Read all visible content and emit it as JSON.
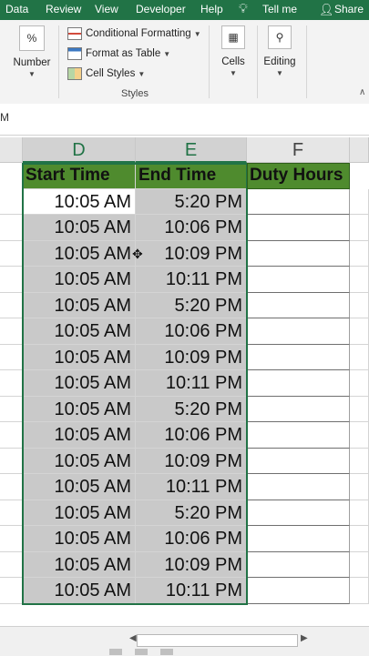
{
  "ribbon_tabs": [
    "Data",
    "Review",
    "View",
    "Developer",
    "Help",
    "Tell me",
    "Share"
  ],
  "ribbon": {
    "number_label": "Number",
    "number_icon": "%",
    "conditional_formatting": "Conditional Formatting",
    "format_as_table": "Format as Table",
    "cell_styles": "Cell Styles",
    "styles_group": "Styles",
    "cells_label": "Cells",
    "editing_label": "Editing"
  },
  "formula_bar": {
    "name_box": "M"
  },
  "columns": [
    "D",
    "E",
    "F"
  ],
  "header_row": {
    "start": "Start Time",
    "end": "End Time",
    "duty": "Duty Hours"
  },
  "rows": [
    {
      "start": "10:05 AM",
      "end": "5:20 PM"
    },
    {
      "start": "10:05 AM",
      "end": "10:06 PM"
    },
    {
      "start": "10:05 AM",
      "end": "10:09 PM"
    },
    {
      "start": "10:05 AM",
      "end": "10:11 PM"
    },
    {
      "start": "10:05 AM",
      "end": "5:20 PM"
    },
    {
      "start": "10:05 AM",
      "end": "10:06 PM"
    },
    {
      "start": "10:05 AM",
      "end": "10:09 PM"
    },
    {
      "start": "10:05 AM",
      "end": "10:11 PM"
    },
    {
      "start": "10:05 AM",
      "end": "5:20 PM"
    },
    {
      "start": "10:05 AM",
      "end": "10:06 PM"
    },
    {
      "start": "10:05 AM",
      "end": "10:09 PM"
    },
    {
      "start": "10:05 AM",
      "end": "10:11 PM"
    },
    {
      "start": "10:05 AM",
      "end": "5:20 PM"
    },
    {
      "start": "10:05 AM",
      "end": "10:06 PM"
    },
    {
      "start": "10:05 AM",
      "end": "10:09 PM"
    },
    {
      "start": "10:05 AM",
      "end": "10:11 PM"
    }
  ],
  "colors": {
    "excel_green": "#217346",
    "header_fill": "#4f8b2e",
    "selection_fill": "#c9c9c9"
  }
}
